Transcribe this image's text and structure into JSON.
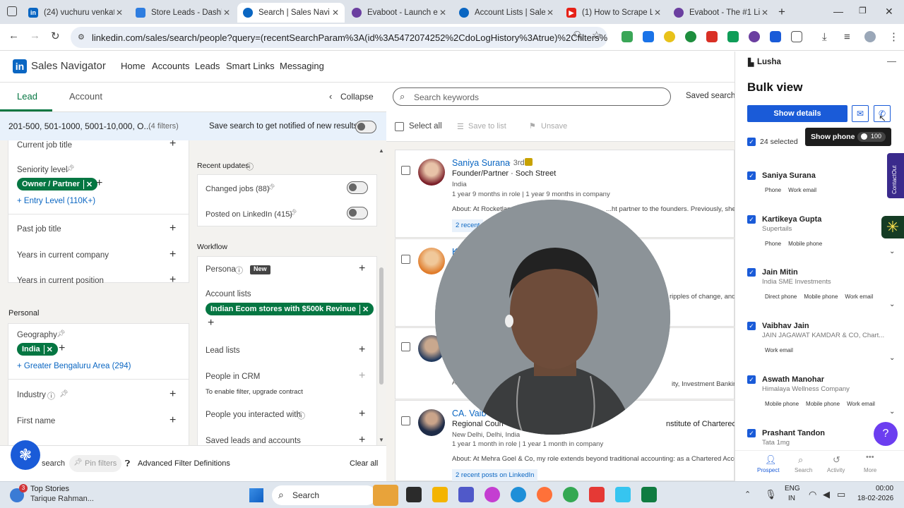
{
  "browser": {
    "tabs": [
      {
        "title": "(24) vuchuru venkata",
        "color": "#0a66c2",
        "letter": "in"
      },
      {
        "title": "Store Leads - Dashbo",
        "color": "#2e7de0",
        "letter": ""
      },
      {
        "title": "Search | Sales Navig",
        "color": "#0a66c2",
        "letter": ""
      },
      {
        "title": "Evaboot - Launch ex",
        "color": "#6b3fa0",
        "letter": ""
      },
      {
        "title": "Account Lists | Sales",
        "color": "#0a66c2",
        "letter": ""
      },
      {
        "title": "(1) How to Scrape Li",
        "color": "#e62117",
        "letter": ""
      },
      {
        "title": "Evaboot - The #1 Lin",
        "color": "#6b3fa0",
        "letter": ""
      }
    ],
    "url": "linkedin.com/sales/search/people?query=(recentSearchParam%3A(id%3A5472074252%2CdoLogHistory%3Atrue)%2Cfilters%3AL...",
    "new_tab": "+"
  },
  "header": {
    "app_title": "Sales Navigator",
    "nav": [
      "Home",
      "Accounts",
      "Leads",
      "Smart Links",
      "Messaging"
    ]
  },
  "left": {
    "tabs": {
      "lead": "Lead",
      "account": "Account",
      "collapse": "Collapse"
    },
    "filter_summary": "201-500, 501-1000, 5001-10,000, O...",
    "filter_count": "(4 filters)",
    "save_search_text": "Save search to get notified of new results",
    "col1": {
      "current_job_title": "Current job title",
      "seniority_label": "Seniority level",
      "seniority_pill": "Owner / Partner",
      "entry_level": "Entry Level (110K+)",
      "past_job_title": "Past job title",
      "years_company": "Years in current company",
      "years_position": "Years in current position",
      "personal_heading": "Personal",
      "geography": "Geography",
      "geo_pill": "India",
      "geo_link": "Greater Bengaluru Area (294)",
      "industry": "Industry",
      "first_name": "First name"
    },
    "col2": {
      "recent_updates": "Recent updates",
      "changed_jobs": "Changed jobs (88)",
      "posted_linkedin": "Posted on LinkedIn (415)",
      "workflow": "Workflow",
      "persona": "Persona",
      "new_badge": "New",
      "account_lists": "Account lists",
      "account_pill": "Indian Ecom stores with $500k Revinue",
      "lead_lists": "Lead lists",
      "people_crm": "People in CRM",
      "crm_note": "To enable filter, upgrade contract",
      "interacted": "People you interacted with",
      "saved_leads": "Saved leads and accounts"
    },
    "footer": {
      "search": "search",
      "pin_filters": "Pin filters",
      "advanced": "Advanced Filter Definitions",
      "clear_all": "Clear all"
    }
  },
  "results": {
    "search_placeholder": "Search keywords",
    "saved_searches": "Saved searche",
    "select_all": "Select all",
    "save_to_list": "Save to list",
    "unsave": "Unsave",
    "cards": [
      {
        "name": "Saniya Surana",
        "degree": "· 3rd",
        "title": "Founder/Partner · Soch Street",
        "location": "India",
        "tenure": "1 year 9 months in role | 1 year 9 months in company",
        "about": "About: At Rocketlane...                                              ...ht partner to the founders. Previously, she worke",
        "posts": "2 recent"
      },
      {
        "name": "K",
        "about": "ripples of change, and"
      },
      {
        "name": "",
        "about": "ity, Investment Banking and L"
      },
      {
        "name": "CA. Vaib",
        "title": "Regional Coun",
        "title_tail": "nstitute of Chartered Accountants of I",
        "location": "New Delhi, Delhi, India",
        "tenure": "1 year 1 month in role | 1 year 1 month in company",
        "about": "About: At Mehra Goel & Co, my role extends beyond traditional accounting: as a Chartered Accountan",
        "posts": "2 recent posts on LinkedIn"
      }
    ]
  },
  "lusha": {
    "brand": "Lusha",
    "title": "Bulk view",
    "show_details": "Show details",
    "tooltip": "Show phone",
    "credits": "100",
    "selected": "24 selected",
    "side_tab": "ContactOut",
    "contacts": [
      {
        "name": "Saniya Surana",
        "company": "",
        "tags": [
          "Phone",
          "Work email"
        ]
      },
      {
        "name": "Kartikeya Gupta",
        "company": "Supertails",
        "tags": [
          "Phone",
          "Mobile phone"
        ]
      },
      {
        "name": "Jain Mitin",
        "company": "India SME Investments",
        "tags": [
          "Direct phone",
          "Mobile phone",
          "Work email"
        ]
      },
      {
        "name": "Vaibhav Jain",
        "company": "JAIN JAGAWAT KAMDAR & CO, Chart...",
        "tags": [
          "Work email"
        ]
      },
      {
        "name": "Aswath Manohar",
        "company": "Himalaya Wellness Company",
        "tags": [
          "Mobile phone",
          "Mobile phone",
          "Work email"
        ]
      },
      {
        "name": "Prashant Tandon",
        "company": "Tata 1mg",
        "tags": []
      }
    ],
    "bottom_nav": [
      "Prospect",
      "Search",
      "Activity",
      "More"
    ],
    "help": "?"
  },
  "taskbar": {
    "news_title": "Top Stories",
    "news_sub": "Tarique Rahman...",
    "news_badge": "3",
    "search": "Search",
    "lang1": "ENG",
    "lang2": "IN",
    "time": "00:00",
    "date": "18-02-2026"
  }
}
